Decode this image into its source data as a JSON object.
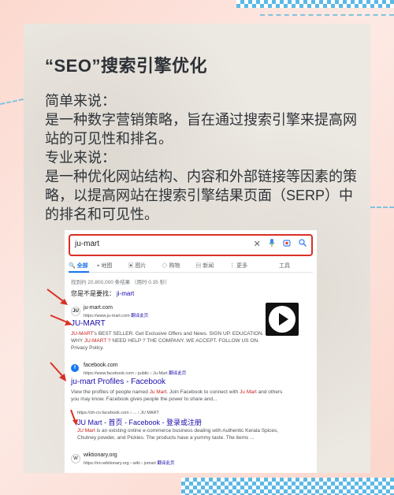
{
  "poster": {
    "title": "“SEO”搜索引擎优化",
    "simple_label": "简单来说：",
    "simple_text": "是一种数字营销策略，旨在通过搜索引擎来提高网站的可见性和排名。",
    "pro_label": "专业来说：",
    "pro_text": "是一种优化网站结构、内容和外部链接等因素的策略，以提高网站在搜索引擎结果页面（SERP）中的排名和可见性。"
  },
  "search": {
    "query": "ju-mart",
    "clear_icon": "✕",
    "mic_icon": "mic-icon",
    "lens_icon": "lens-icon",
    "search_icon": "search-icon"
  },
  "tabs": [
    "全部",
    "地图",
    "图片",
    "购物",
    "新闻",
    "更多"
  ],
  "tools": "工具",
  "result_stats": "找到约 20,800,000 条结果 （用时 0.35 秒）",
  "did_you_mean": {
    "label": "您是不是要找：",
    "suggestion": "ji-mart"
  },
  "results": [
    {
      "site": "ju-mart.com",
      "url": "https://www.ju-mart.com",
      "translate": "翻译此页",
      "title": "JU-MART",
      "snippet_em1": "JU-MART",
      "snippet_a": "'s BEST SELLER. Get Exclusive Offers and News. SIGN UP. EDUCATION.",
      "snippet_b": "WHY ",
      "snippet_em2": "JU-MART ?",
      "snippet_c": "  NEED HELP ? THE COMPANY. WE ACCEPT. FOLLOW US ON.",
      "snippet_d": "Privacy Policy."
    },
    {
      "site": "facebook.com",
      "url": "https://www.facebook.com › public › Ju-Mart",
      "translate": "翻译此页",
      "title": "ju-mart Profiles - Facebook",
      "snippet_a": "View the profiles of people named ",
      "snippet_em1": "Ju Mart",
      "snippet_b": ". Join Facebook to connect with ",
      "snippet_em2": "Ju Mart",
      "snippet_c": " and others",
      "snippet_d": "you may know. Facebook gives people the power to share and..."
    },
    {
      "url": "https://zh-cn.facebook.com › ... › JU MART",
      "title": "JU Mart - 首页 - Facebook - 登录或注册",
      "snippet_em1": "JU Mart",
      "snippet_a": " is an existing online e-commerce business dealing with Authentic Kerala Spices,",
      "snippet_d": "Chutney powder, and Pickles. The products have a yummy taste. The items ..."
    },
    {
      "site": "wiktionary.org",
      "url": "https://en.wiktionary.org › wiki › jumart",
      "translate": "翻译此页"
    }
  ],
  "colors": {
    "accent_red": "#d93025",
    "link": "#1a0dab",
    "google_blue": "#1a73e8"
  }
}
